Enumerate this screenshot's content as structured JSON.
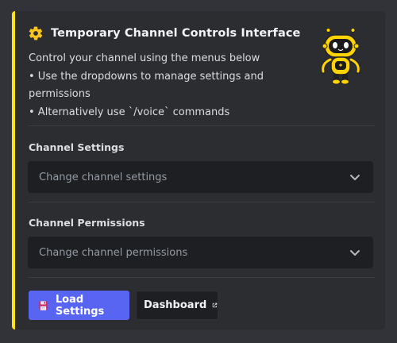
{
  "embed": {
    "accent_color": "#ffe01b",
    "title_icon": "gear-icon",
    "title": "Temporary Channel Controls Interface",
    "description_lines": [
      "Control your channel using the menus below",
      "• Use the dropdowns to manage settings and",
      "permissions",
      "• Alternatively use `/voice` commands"
    ],
    "thumbnail": "robot-mascot-image"
  },
  "channel_settings": {
    "label": "Channel Settings",
    "placeholder": "Change channel settings",
    "icon": "chevron-down-icon"
  },
  "channel_permissions": {
    "label": "Channel Permissions",
    "placeholder": "Change channel permissions",
    "icon": "chevron-down-icon"
  },
  "buttons": {
    "load_settings": {
      "label": "Load Settings",
      "icon": "floppy-disk-icon",
      "color": "#5865f2"
    },
    "dashboard": {
      "label": "Dashboard",
      "icon": "external-link-icon"
    }
  }
}
